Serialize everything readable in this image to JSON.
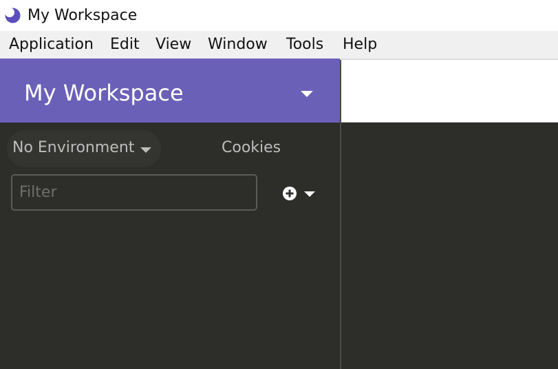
{
  "window": {
    "title": "My Workspace",
    "icon": "moon-icon",
    "accent_color": "#6b60b8"
  },
  "menubar": {
    "items": [
      "Application",
      "Edit",
      "View",
      "Window",
      "Tools",
      "Help"
    ]
  },
  "sidebar": {
    "workspace_title": "My Workspace",
    "environment_label": "No Environment",
    "cookies_label": "Cookies",
    "filter_placeholder": "Filter",
    "filter_value": "",
    "add_button_icon": "plus-circle-icon"
  }
}
